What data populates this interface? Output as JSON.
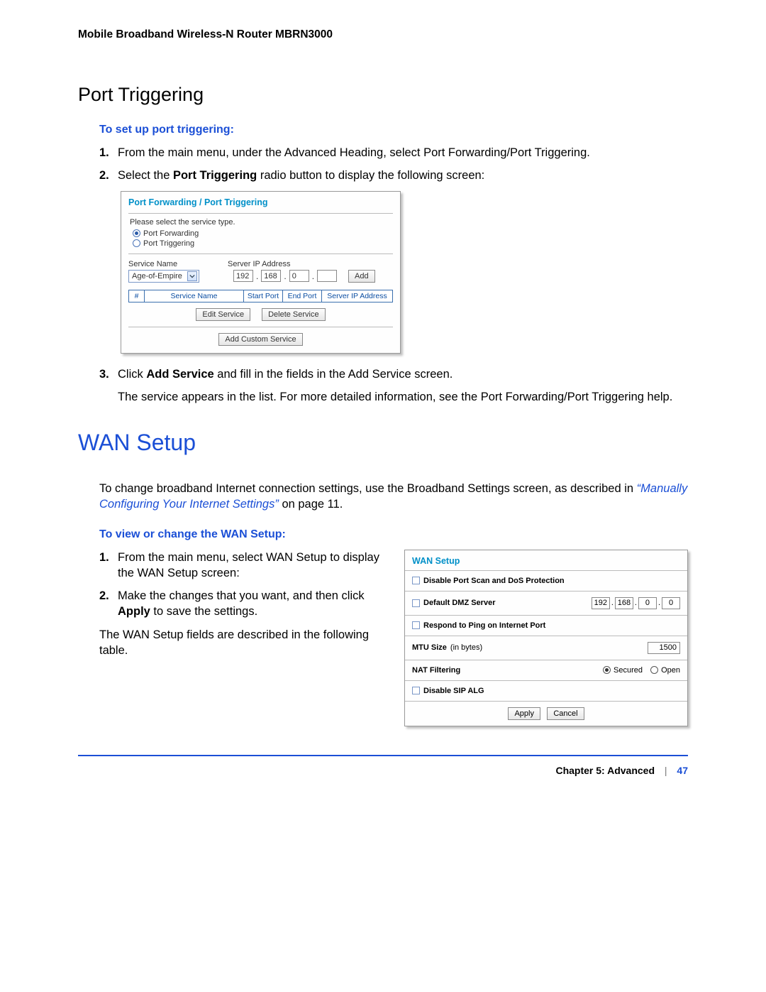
{
  "header": "Mobile Broadband Wireless-N Router MBRN3000",
  "section1": {
    "title": "Port Triggering",
    "instr_heading": "To set up port triggering:",
    "step1": "From the main menu, under the Advanced Heading, select Port Forwarding/Port Triggering.",
    "step2_pre": "Select the ",
    "step2_bold": "Port Triggering",
    "step2_post": " radio button to display the following screen:",
    "step3_pre": "Click ",
    "step3_bold": "Add Service",
    "step3_post": " and fill in the fields in the Add Service screen.",
    "step3_follow": "The service appears in the list. For more detailed information, see the Port Forwarding/Port Triggering help."
  },
  "panel1": {
    "title": "Port Forwarding / Port Triggering",
    "select_label": "Please select the service type.",
    "opt1": "Port Forwarding",
    "opt2": "Port Triggering",
    "svc_name_hdr": "Service Name",
    "svc_ip_hdr": "Server IP Address",
    "svc_sel": "Age-of-Empire",
    "ip1": "192",
    "ip2": "168",
    "ip3": "0",
    "ip4": "",
    "add": "Add",
    "th_hash": "#",
    "th_svc": "Service Name",
    "th_sp": "Start Port",
    "th_ep": "End Port",
    "th_ip": "Server IP Address",
    "edit": "Edit Service",
    "delete": "Delete Service",
    "addcust": "Add Custom Service"
  },
  "section2": {
    "title": "WAN Setup",
    "intro_pre": "To change broadband Internet connection settings, use the Broadband Settings screen, as described in ",
    "intro_link": "“Manually Configuring Your Internet Settings”",
    "intro_post": " on page 11.",
    "instr_heading": "To view or change the WAN Setup:",
    "step1": "From the main menu, select WAN Setup to display the WAN Setup screen:",
    "step2_pre": "Make the changes that you want, and then click ",
    "step2_bold": "Apply",
    "step2_post": " to save the settings.",
    "follow": "The WAN Setup fields are described in the following table."
  },
  "panel2": {
    "title": "WAN Setup",
    "row1": "Disable Port Scan and DoS Protection",
    "row2": "Default DMZ Server",
    "ip1": "192",
    "ip2": "168",
    "ip3": "0",
    "ip4": "0",
    "row3": "Respond to Ping on Internet Port",
    "row4a": "MTU Size",
    "row4b": "(in bytes)",
    "mtu": "1500",
    "row5": "NAT Filtering",
    "secured": "Secured",
    "open": "Open",
    "row6": "Disable SIP ALG",
    "apply": "Apply",
    "cancel": "Cancel"
  },
  "footer": {
    "chapter": "Chapter 5:  Advanced",
    "page": "47"
  }
}
